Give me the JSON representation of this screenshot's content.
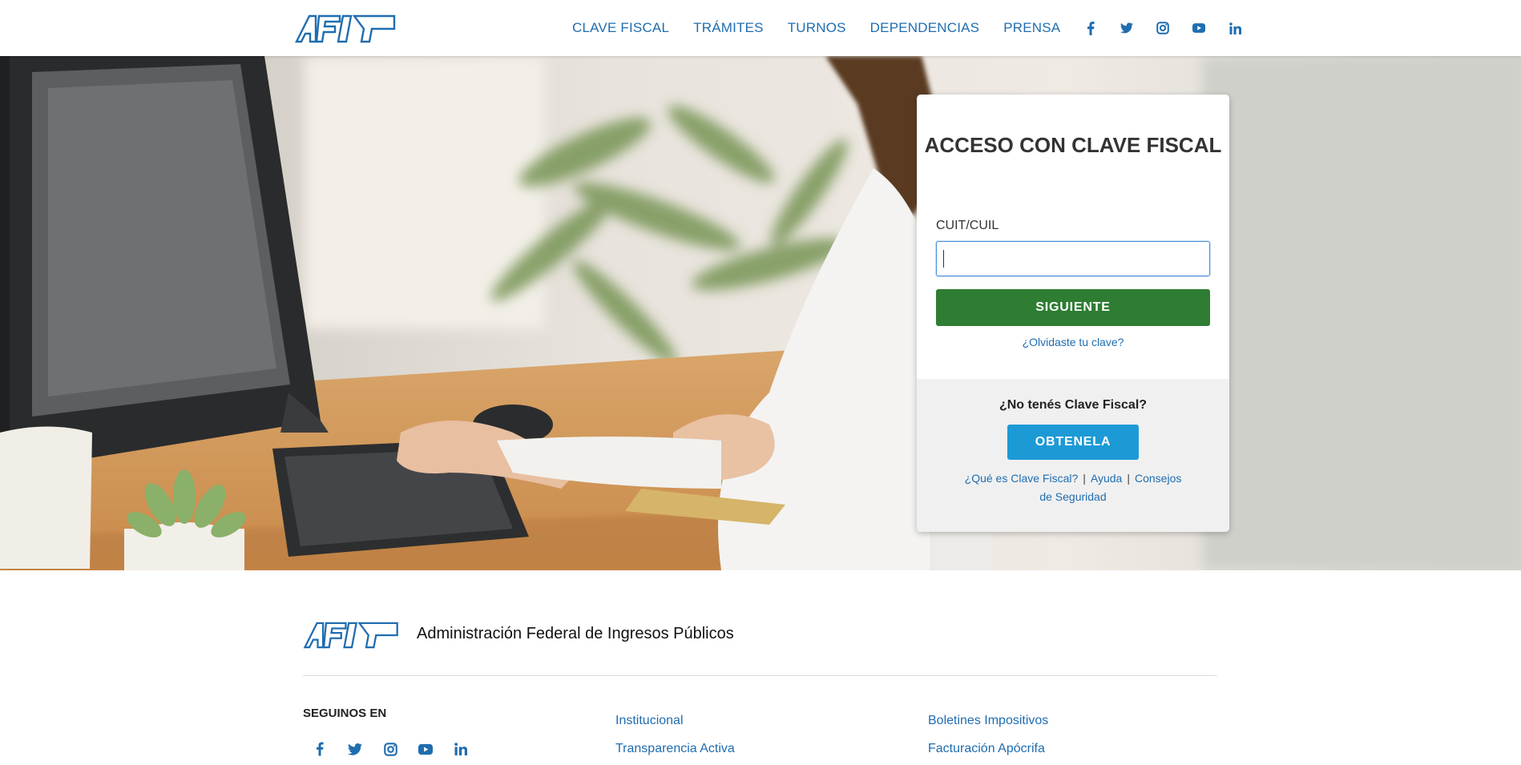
{
  "brand": {
    "logo_text": "AFIP",
    "accent_color": "#1f6db0"
  },
  "header": {
    "nav": [
      "CLAVE FISCAL",
      "TRÁMITES",
      "TURNOS",
      "DEPENDENCIAS",
      "PRENSA"
    ],
    "social_icons": [
      "facebook-icon",
      "twitter-icon",
      "instagram-icon",
      "youtube-icon",
      "linkedin-icon"
    ]
  },
  "login": {
    "title": "ACCESO CON CLAVE FISCAL",
    "field_label": "CUIT/CUIL",
    "field_value": "",
    "submit_label": "SIGUIENTE",
    "submit_color": "#2e7d32",
    "forgot_link": "¿Olvidaste tu clave?",
    "no_account_text": "¿No tenés Clave Fiscal?",
    "get_label": "OBTENELA",
    "get_color": "#1c9ad6",
    "help_links": [
      "¿Qué es Clave Fiscal?",
      "Ayuda",
      "Consejos de Seguridad"
    ],
    "separator": "|"
  },
  "footer": {
    "org_name": "Administración Federal de Ingresos Públicos",
    "follow_label": "SEGUINOS EN",
    "col2": [
      "Institucional",
      "Transparencia Activa"
    ],
    "col3": [
      "Boletines Impositivos",
      "Facturación Apócrifa"
    ]
  }
}
